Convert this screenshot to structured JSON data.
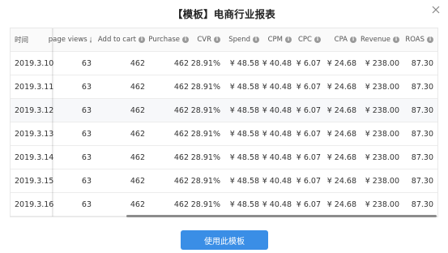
{
  "dialog": {
    "title": "【模板】电商行业报表",
    "use_button_label": "使用此模板"
  },
  "table": {
    "columns": [
      "时间",
      "page views",
      "Add to cart",
      "Purchase",
      "CVR",
      "Spend",
      "CPM",
      "CPC",
      "CPA",
      "Revenue",
      "ROAS"
    ],
    "rows": [
      [
        "2019.3.10",
        "63",
        "462",
        "462",
        "28.91%",
        "¥ 48.58",
        "¥ 40.48",
        "¥ 6.07",
        "¥ 24.68",
        "¥ 238.00",
        "87.30"
      ],
      [
        "2019.3.11",
        "63",
        "462",
        "462",
        "28.91%",
        "¥ 48.58",
        "¥ 40.48",
        "¥ 6.07",
        "¥ 24.68",
        "¥ 238.00",
        "87.30"
      ],
      [
        "2019.3.12",
        "63",
        "462",
        "462",
        "28.91%",
        "¥ 48.58",
        "¥ 40.48",
        "¥ 6.07",
        "¥ 24.68",
        "¥ 238.00",
        "87.30"
      ],
      [
        "2019.3.13",
        "63",
        "462",
        "462",
        "28.91%",
        "¥ 48.58",
        "¥ 40.48",
        "¥ 6.07",
        "¥ 24.68",
        "¥ 238.00",
        "87.30"
      ],
      [
        "2019.3.14",
        "63",
        "462",
        "462",
        "28.91%",
        "¥ 48.58",
        "¥ 40.48",
        "¥ 6.07",
        "¥ 24.68",
        "¥ 238.00",
        "87.30"
      ],
      [
        "2019.3.15",
        "63",
        "462",
        "462",
        "28.91%",
        "¥ 48.58",
        "¥ 40.48",
        "¥ 6.07",
        "¥ 24.68",
        "¥ 238.00",
        "87.30"
      ],
      [
        "2019.3.16",
        "63",
        "462",
        "462",
        "28.91%",
        "¥ 48.58",
        "¥ 40.48",
        "¥ 6.07",
        "¥ 24.68",
        "¥ 238.00",
        "87.30"
      ]
    ],
    "highlighted_row": 2
  },
  "icons": {
    "close": "close-icon",
    "column_info": "info-icon"
  },
  "colors": {
    "primary_button": "#3a8ee6",
    "row_highlight": "#f7f8fa"
  }
}
